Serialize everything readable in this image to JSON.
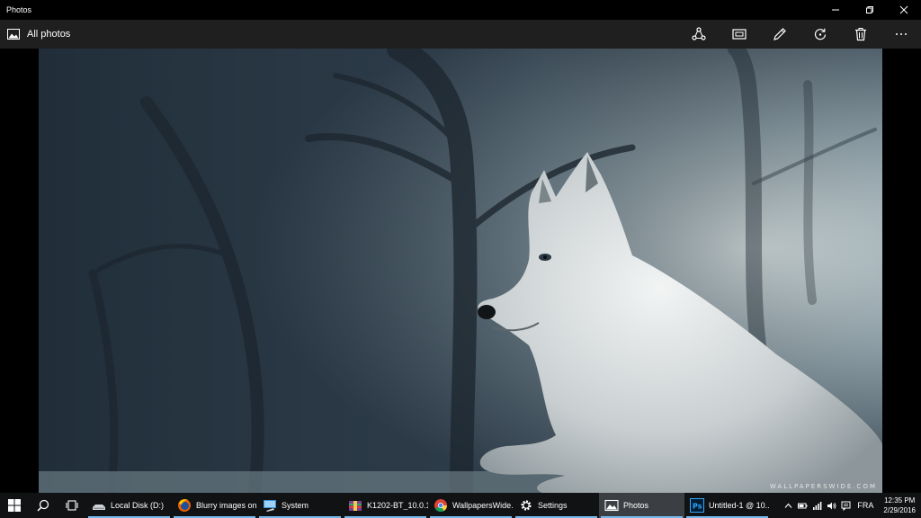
{
  "window": {
    "title": "Photos"
  },
  "commandbar": {
    "back_label": "All photos",
    "buttons": [
      {
        "icon": "share-icon"
      },
      {
        "icon": "slideshow-icon"
      },
      {
        "icon": "edit-pencil-icon"
      },
      {
        "icon": "rotate-icon"
      },
      {
        "icon": "delete-icon"
      },
      {
        "icon": "more-icon"
      }
    ]
  },
  "photo": {
    "watermark": "WALLPAPERSWIDE.COM"
  },
  "taskbar": {
    "apps": [
      {
        "label": "Local Disk (D:)",
        "icon": "drive-icon",
        "active": false
      },
      {
        "label": "Blurry images on...",
        "icon": "firefox-icon",
        "active": false
      },
      {
        "label": "System",
        "icon": "system-icon",
        "active": false
      },
      {
        "label": "K1202-BT_10.0.1...",
        "icon": "archive-icon",
        "active": false
      },
      {
        "label": "WallpapersWide...",
        "icon": "chrome-icon",
        "active": false
      },
      {
        "label": "Settings",
        "icon": "settings-gear-icon",
        "active": false
      },
      {
        "label": "Photos",
        "icon": "photos-icon",
        "active": true
      },
      {
        "label": "Untitled-1 @ 10...",
        "icon": "photoshop-icon",
        "active": false
      }
    ],
    "tray": {
      "language": "FRA",
      "time": "12:35 PM",
      "date": "2/29/2016"
    }
  }
}
